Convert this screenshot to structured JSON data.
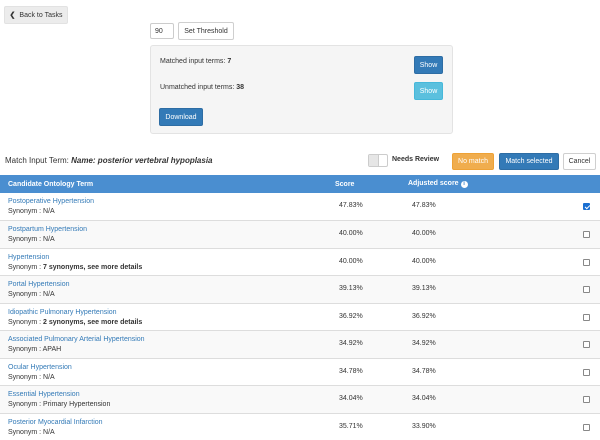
{
  "nav": {
    "back_label": "Back to Tasks"
  },
  "threshold": {
    "value": "90",
    "set_label": "Set Threshold"
  },
  "stats": {
    "matched_label": "Matched input terms:",
    "matched_count": "7",
    "unmatched_label": "Unmatched input terms:",
    "unmatched_count": "38",
    "show_label": "Show",
    "download_label": "Download"
  },
  "match_header": {
    "prefix": "Match Input Term:",
    "term": "Name: posterior vertebral hypoplasia",
    "needs_review_label": "Needs Review",
    "no_match_label": "No match",
    "match_selected_label": "Match selected",
    "cancel_label": "Cancel"
  },
  "table": {
    "headers": {
      "term": "Candidate Ontology Term",
      "score": "Score",
      "adjusted": "Adjusted score"
    },
    "rows": [
      {
        "term": "Postoperative Hypertension",
        "syn_label": "Synonym :",
        "synonym": "N/A",
        "synonym_bold": false,
        "score": "47.83%",
        "adjusted": "47.83%",
        "checked": true
      },
      {
        "term": "Postpartum Hypertension",
        "syn_label": "Synonym :",
        "synonym": "N/A",
        "synonym_bold": false,
        "score": "40.00%",
        "adjusted": "40.00%",
        "checked": false
      },
      {
        "term": "Hypertension",
        "syn_label": "Synonym :",
        "synonym": "7 synonyms, see more details",
        "synonym_bold": true,
        "score": "40.00%",
        "adjusted": "40.00%",
        "checked": false
      },
      {
        "term": "Portal Hypertension",
        "syn_label": "Synonym :",
        "synonym": "N/A",
        "synonym_bold": false,
        "score": "39.13%",
        "adjusted": "39.13%",
        "checked": false
      },
      {
        "term": "Idiopathic Pulmonary Hypertension",
        "syn_label": "Synonym :",
        "synonym": "2 synonyms, see more details",
        "synonym_bold": true,
        "score": "36.92%",
        "adjusted": "36.92%",
        "checked": false
      },
      {
        "term": "Associated Pulmonary Arterial Hypertension",
        "syn_label": "Synonym :",
        "synonym": "APAH",
        "synonym_bold": false,
        "score": "34.92%",
        "adjusted": "34.92%",
        "checked": false
      },
      {
        "term": "Ocular Hypertension",
        "syn_label": "Synonym :",
        "synonym": "N/A",
        "synonym_bold": false,
        "score": "34.78%",
        "adjusted": "34.78%",
        "checked": false
      },
      {
        "term": "Essential Hypertension",
        "syn_label": "Synonym :",
        "synonym": "Primary Hypertension",
        "synonym_bold": false,
        "score": "34.04%",
        "adjusted": "34.04%",
        "checked": false
      },
      {
        "term": "Posterior Myocardial Infarction",
        "syn_label": "Synonym :",
        "synonym": "N/A",
        "synonym_bold": false,
        "score": "35.71%",
        "adjusted": "33.90%",
        "checked": false
      }
    ]
  }
}
